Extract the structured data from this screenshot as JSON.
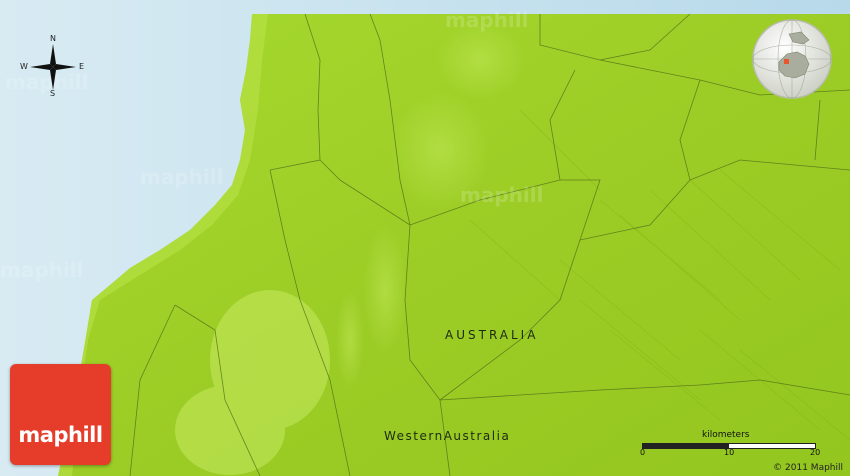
{
  "map": {
    "country_label": "AUSTRALIA",
    "state_label": "WesternAustralia"
  },
  "compass": {
    "north": "N",
    "south": "S",
    "east": "E",
    "west": "W"
  },
  "logo": {
    "text": "maphill"
  },
  "scale": {
    "title": "kilometers",
    "ticks": [
      "0",
      "10",
      "20"
    ]
  },
  "copyright": "© 2011 Maphill",
  "watermark": "maphill",
  "colors": {
    "water": "#cfe6f0",
    "land": "#9fd22a",
    "logo": "#e53d2a",
    "inset_marker": "#e8562e"
  }
}
